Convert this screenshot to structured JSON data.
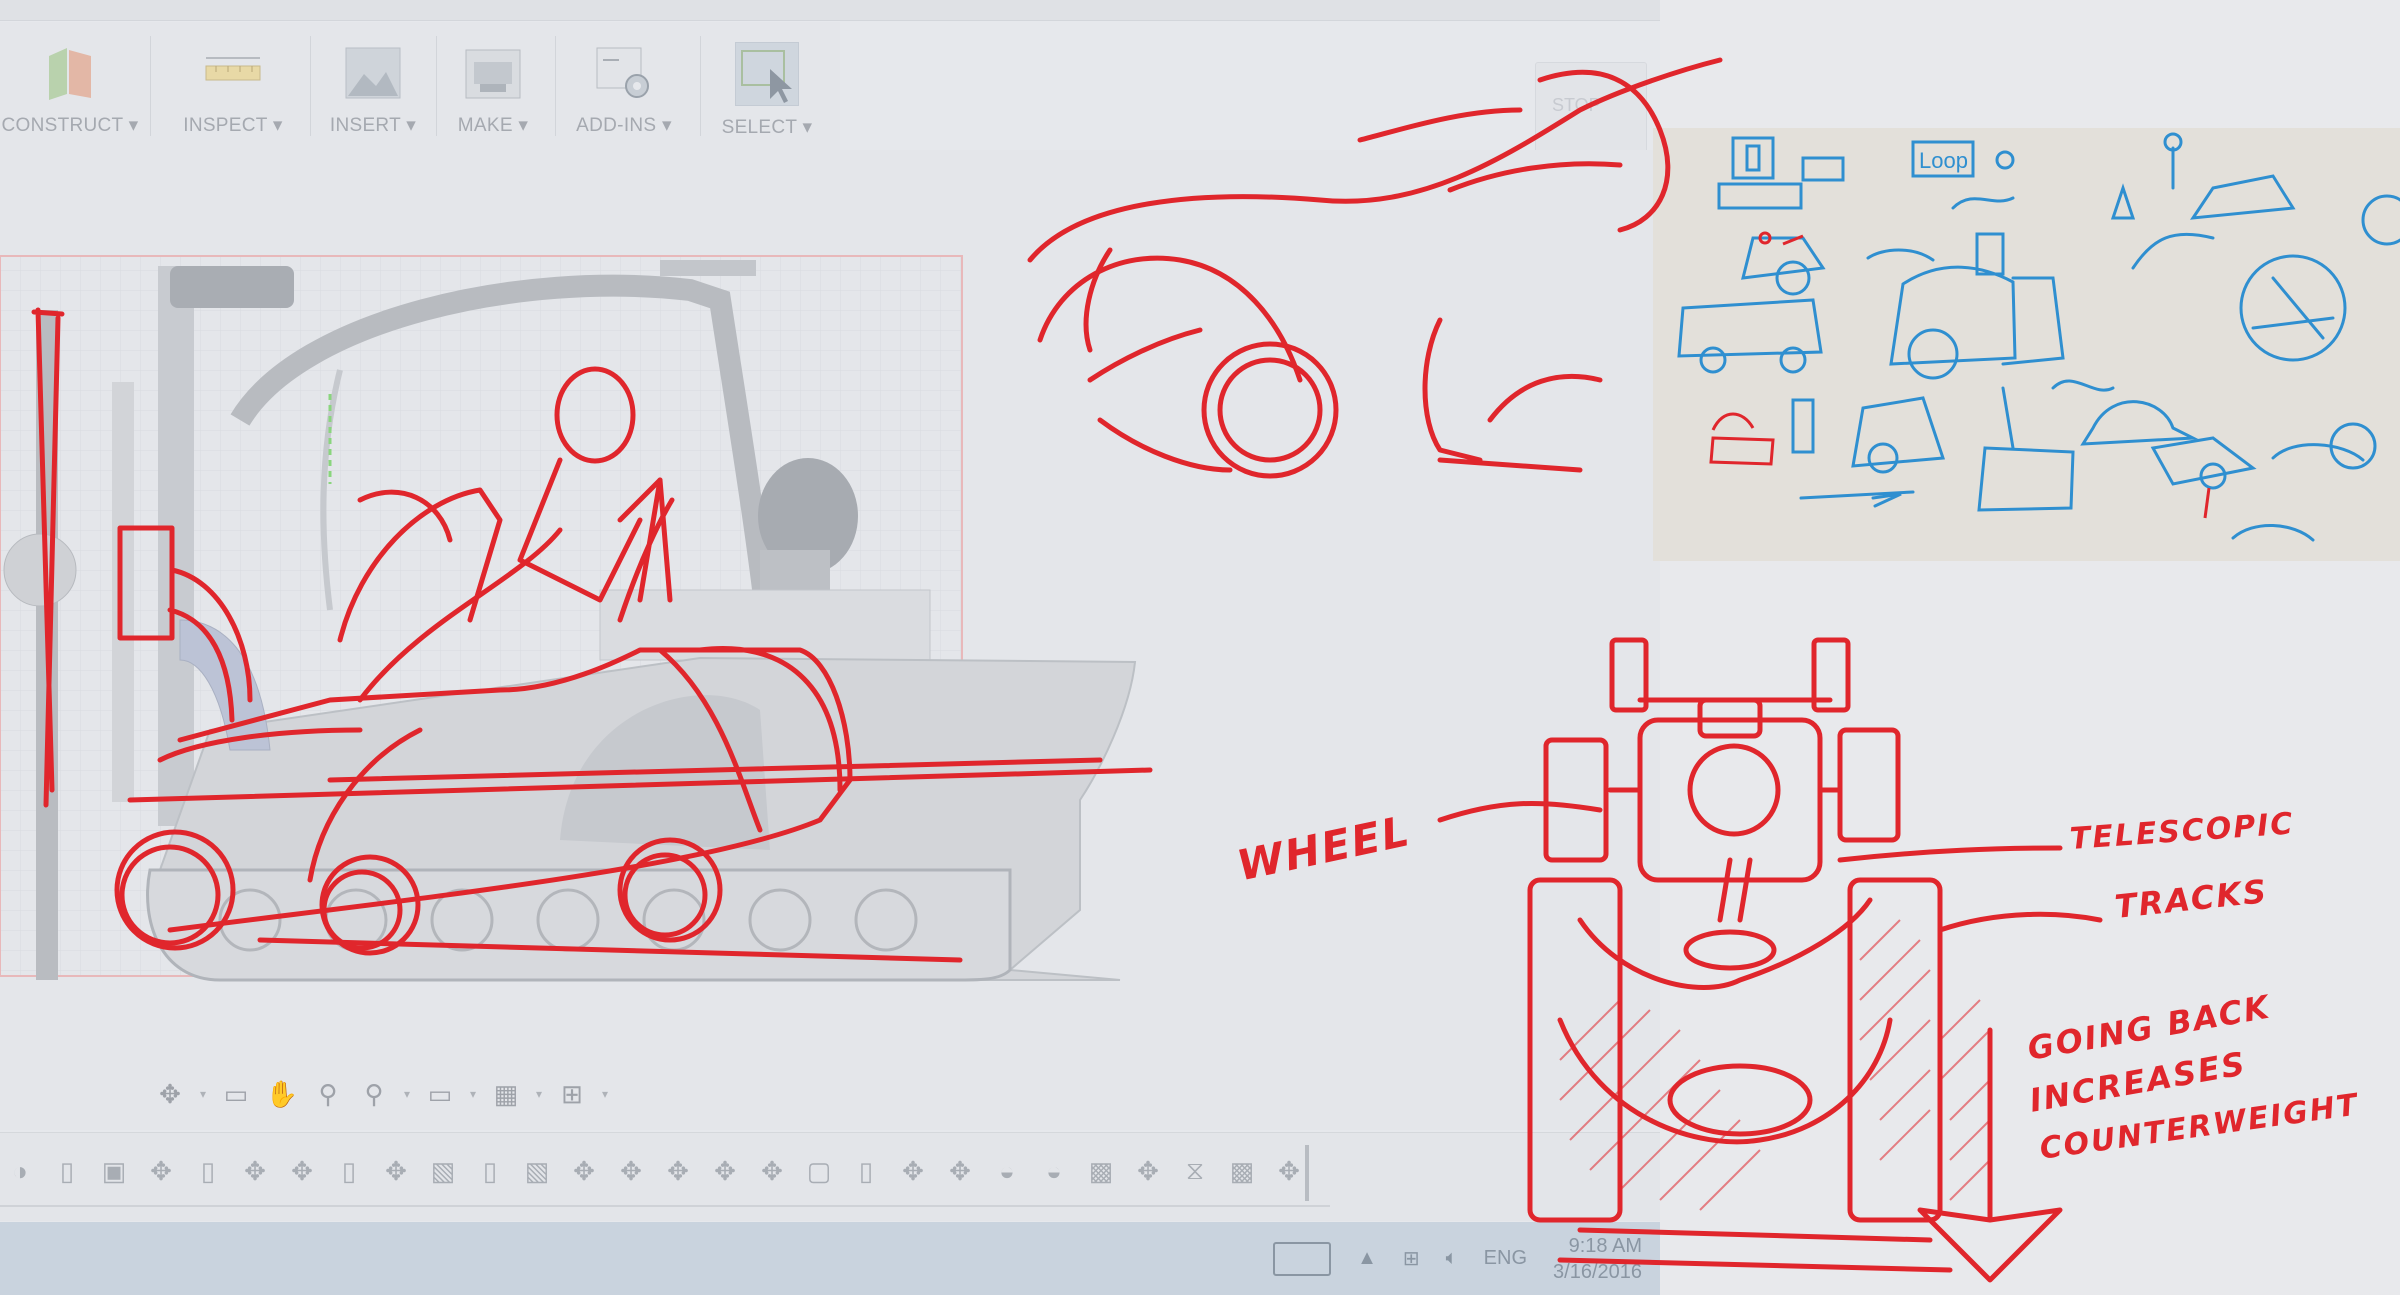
{
  "toolbar": {
    "items": [
      {
        "label": "CONSTRUCT ▾",
        "icon": "construct-icon"
      },
      {
        "label": "INSPECT ▾",
        "icon": "ruler-icon"
      },
      {
        "label": "INSERT ▾",
        "icon": "image-icon"
      },
      {
        "label": "MAKE ▾",
        "icon": "printer-icon"
      },
      {
        "label": "ADD-INS ▾",
        "icon": "scripts-gear-icon"
      },
      {
        "label": "SELECT ▾",
        "icon": "cursor-select-icon"
      }
    ],
    "stop_label": "STOP"
  },
  "taskbar": {
    "language": "ENG",
    "time": "9:18 AM",
    "date": "3/16/2016"
  },
  "annotations": {
    "wheel": "WHEEL",
    "telescopic": "TELESCOPIC",
    "tracks": "TRACKS",
    "note_line1": "GOING BACK",
    "note_line2": "INCREASES",
    "note_line3": "COUNTERWEIGHT"
  },
  "whiteboard_label": "Loop",
  "colors": {
    "sketch_red": "#e0262c",
    "whiteboard_blue": "#2f8fd0",
    "taskbar": "#c9d3de"
  }
}
